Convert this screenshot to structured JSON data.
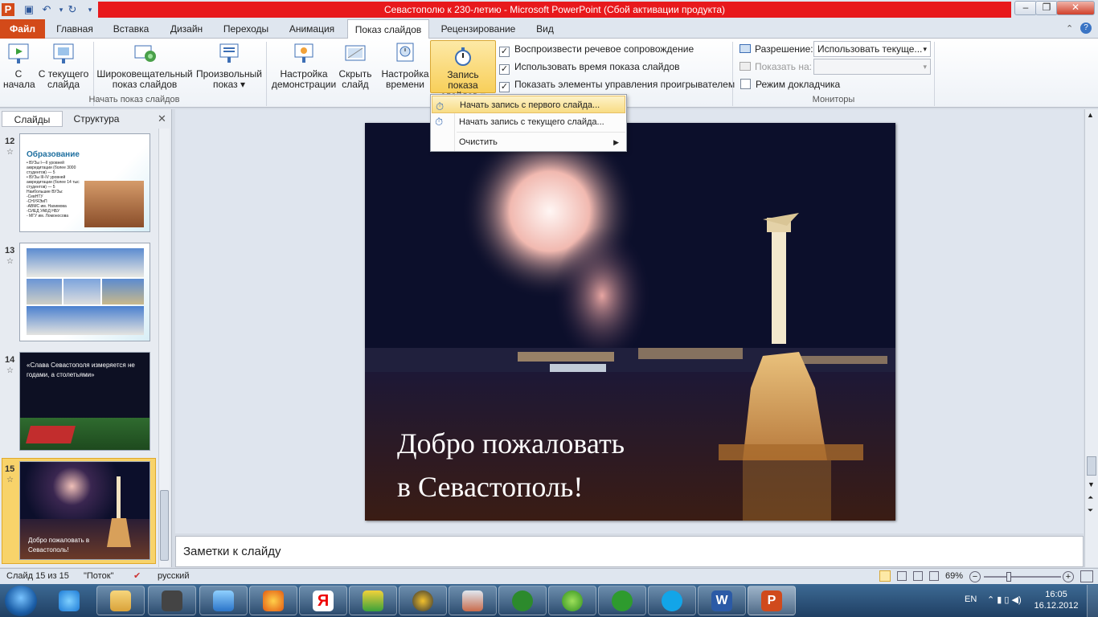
{
  "window": {
    "title": "Севастополю к 230-летию  -  Microsoft PowerPoint (Сбой активации продукта)"
  },
  "tabs": [
    "Файл",
    "Главная",
    "Вставка",
    "Дизайн",
    "Переходы",
    "Анимация",
    "Показ слайдов",
    "Рецензирование",
    "Вид"
  ],
  "ribbon": {
    "btn_from_start": "С начала",
    "btn_from_current": "С текущего слайда",
    "btn_broadcast": "Широковещательный показ слайдов",
    "btn_custom": "Произвольный показ",
    "group_start": "Начать показ слайдов",
    "btn_setup": "Настройка демонстрации",
    "btn_hide": "Скрыть слайд",
    "btn_timing": "Настройка времени",
    "btn_record": "Запись показа слайдов",
    "chk_narration": "Воспроизвести речевое сопровождение",
    "chk_timings": "Использовать время показа слайдов",
    "chk_controls": "Показать элементы управления проигрывателем",
    "resolution_label": "Разрешение:",
    "resolution_value": "Использовать текуще...",
    "show_on_label": "Показать на:",
    "presenter_view": "Режим докладчика",
    "group_monitors": "Мониторы"
  },
  "menu": {
    "item1": "Начать запись с первого слайда...",
    "item2": "Начать запись с текущего слайда...",
    "item3": "Очистить"
  },
  "pane": {
    "tab_slides": "Слайды",
    "tab_outline": "Структура"
  },
  "thumbs": [
    {
      "num": "12",
      "title": "Образование",
      "text": "• ВУЗы I—II уровней аккредитации (более 3000 студентов) — 5\n• ВУЗы III-IV уровней аккредитации (более 14 тыс студентов) — 5\nНаибольшие ВУЗы:\n-СевНТУ\n-СНУЯЭиП\n-АВМС им. Нахимова\n-СИЕД УАБД НБУ\n- МГУ им. Ломоносова"
    },
    {
      "num": "13"
    },
    {
      "num": "14",
      "text": "«Слава Севастополя измеряется не годами, а столетьями»"
    },
    {
      "num": "15",
      "text": "Добро пожаловать в Севастополь!"
    }
  ],
  "slide": {
    "line1": "Добро пожаловать",
    "line2": "в Севастополь!"
  },
  "notes_placeholder": "Заметки к слайду",
  "status": {
    "slide_info": "Слайд 15 из 15",
    "theme": "\"Поток\"",
    "language": "русский",
    "zoom": "69%"
  },
  "tray": {
    "lang": "EN",
    "time": "16:05",
    "date": "16.12.2012"
  },
  "colors": {
    "file_tab": "#d34a19",
    "title_bar": "#e8191c",
    "selected_thumb": "#f5c23a"
  }
}
